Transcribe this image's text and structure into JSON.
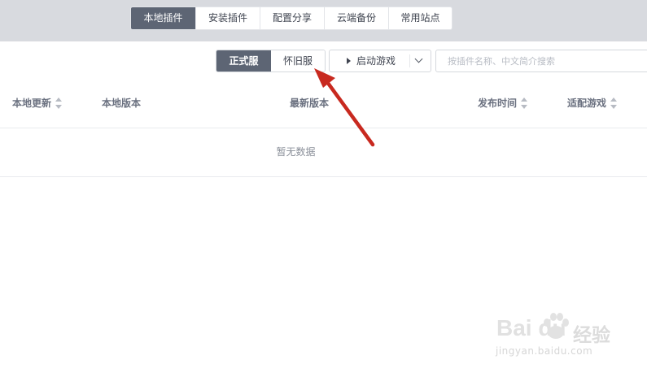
{
  "nav": {
    "tabs": [
      {
        "label": "本地插件",
        "active": true
      },
      {
        "label": "安装插件",
        "active": false
      },
      {
        "label": "配置分享",
        "active": false
      },
      {
        "label": "云端备份",
        "active": false
      },
      {
        "label": "常用站点",
        "active": false
      }
    ]
  },
  "toolbar": {
    "server_toggle": {
      "options": [
        "正式服",
        "怀旧服"
      ],
      "selected": "正式服"
    },
    "launch_label": "启动游戏",
    "search_placeholder": "按插件名称、中文简介搜索"
  },
  "table": {
    "columns": [
      {
        "label": "本地更新",
        "sortable": true
      },
      {
        "label": "本地版本",
        "sortable": false
      },
      {
        "label": "最新版本",
        "sortable": false
      },
      {
        "label": "发布时间",
        "sortable": true
      },
      {
        "label": "适配游戏",
        "sortable": true
      }
    ],
    "empty_text": "暂无数据"
  },
  "watermark": {
    "brand": "Bai du",
    "suffix": "经验",
    "url": "jingyan.baidu.com"
  },
  "colors": {
    "header_bg": "#d8dadf",
    "active_bg": "#5d6574",
    "annotation_arrow": "#c8291f"
  },
  "icons": [
    "play-icon",
    "chevron-down-icon",
    "sort-icon",
    "annotation-arrow",
    "paw-icon"
  ]
}
